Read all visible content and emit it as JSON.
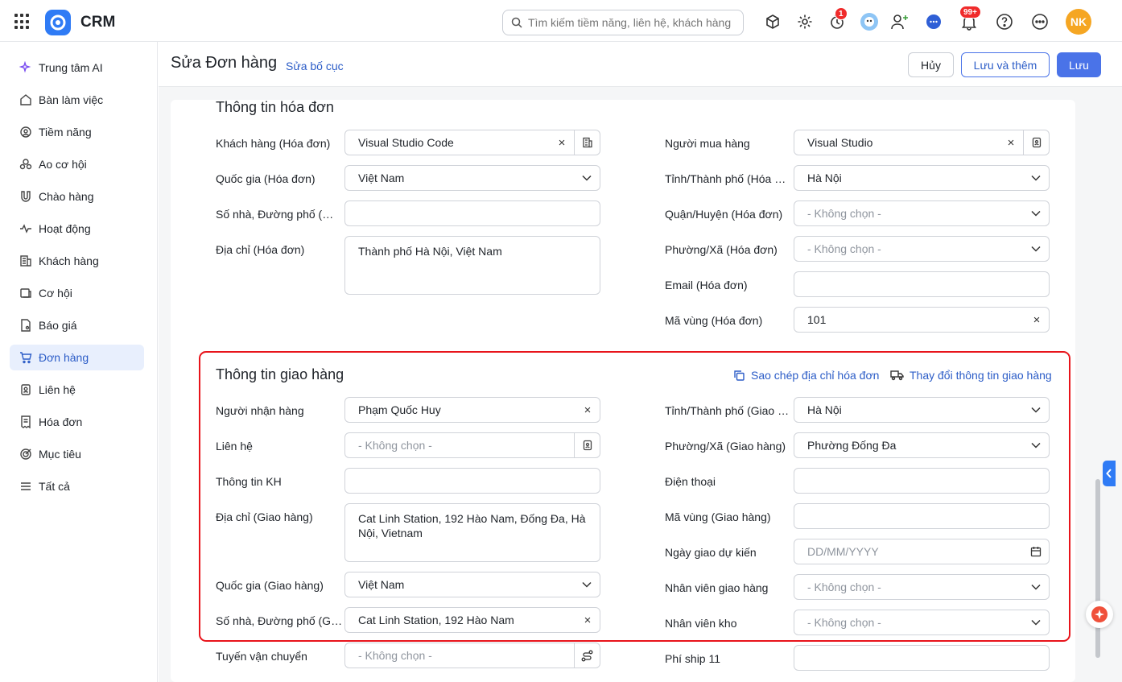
{
  "app": {
    "title": "CRM"
  },
  "search": {
    "placeholder": "Tìm kiếm tiềm năng, liên hệ, khách hàng"
  },
  "topbar": {
    "timer_badge": "1",
    "notif_badge": "99+",
    "avatar_initials": "NK"
  },
  "sidebar": {
    "items": [
      {
        "label": "Trung tâm AI",
        "icon": "sparkle-icon"
      },
      {
        "label": "Bàn làm việc",
        "icon": "home-icon"
      },
      {
        "label": "Tiềm năng",
        "icon": "target-user-icon"
      },
      {
        "label": "Ao cơ hội",
        "icon": "people-icon"
      },
      {
        "label": "Chào hàng",
        "icon": "magnet-icon"
      },
      {
        "label": "Hoạt động",
        "icon": "pulse-icon"
      },
      {
        "label": "Khách hàng",
        "icon": "building-icon"
      },
      {
        "label": "Cơ hội",
        "icon": "money-icon"
      },
      {
        "label": "Báo giá",
        "icon": "quote-doc-icon"
      },
      {
        "label": "Đơn hàng",
        "icon": "cart-icon",
        "active": true
      },
      {
        "label": "Liên hệ",
        "icon": "contact-icon"
      },
      {
        "label": "Hóa đơn",
        "icon": "invoice-icon"
      },
      {
        "label": "Mục tiêu",
        "icon": "goal-icon"
      },
      {
        "label": "Tất cả",
        "icon": "menu-icon"
      }
    ]
  },
  "page": {
    "title": "Sửa Đơn hàng",
    "edit_layout": "Sửa bố cục",
    "cancel": "Hủy",
    "save_add": "Lưu và thêm",
    "save": "Lưu"
  },
  "invoice": {
    "title": "Thông tin hóa đơn",
    "customer_label": "Khách hàng (Hóa đơn)",
    "customer_value": "Visual Studio Code",
    "country_label": "Quốc gia (Hóa đơn)",
    "country_value": "Việt Nam",
    "street_label": "Số nhà, Đường phố (Hóa đơn)",
    "street_value": "",
    "address_label": "Địa chỉ (Hóa đơn)",
    "address_value": "Thành phố Hà Nội, Việt Nam",
    "buyer_label": "Người mua hàng",
    "buyer_value": "Visual Studio",
    "province_label": "Tỉnh/Thành phố (Hóa đơn)",
    "province_value": "Hà Nội",
    "district_label": "Quận/Huyện (Hóa đơn)",
    "district_placeholder": "- Không chọn -",
    "ward_label": "Phường/Xã (Hóa đơn)",
    "ward_placeholder": "- Không chọn -",
    "email_label": "Email (Hóa đơn)",
    "email_value": "",
    "area_code_label": "Mã vùng (Hóa đơn)",
    "area_code_value": "101"
  },
  "shipping": {
    "title": "Thông tin giao hàng",
    "copy_action": "Sao chép địa chỉ hóa đơn",
    "change_action": "Thay đổi thông tin giao hàng",
    "recipient_label": "Người nhận hàng",
    "recipient_value": "Phạm Quốc Huy",
    "contact_label": "Liên hệ",
    "contact_placeholder": "- Không chọn -",
    "cust_info_label": "Thông tin KH",
    "cust_info_value": "",
    "address_label": "Địa chỉ (Giao hàng)",
    "address_value": "Cat Linh Station, 192 Hào Nam, Đống Đa, Hà Nội, Vietnam",
    "country_label": "Quốc gia (Giao hàng)",
    "country_value": "Việt Nam",
    "street_label": "Số nhà, Đường phố (Giao hàng)",
    "street_value": "Cat Linh Station, 192 Hào Nam",
    "province_label": "Tỉnh/Thành phố (Giao hàng)",
    "province_value": "Hà Nội",
    "ward_label": "Phường/Xã (Giao hàng)",
    "ward_value": "Phường Đống Đa",
    "phone_label": "Điện thoại",
    "phone_value": "",
    "area_code_label": "Mã vùng (Giao hàng)",
    "area_code_value": "",
    "expected_date_label": "Ngày giao dự kiến",
    "expected_date_placeholder": "DD/MM/YYYY",
    "shipper_label": "Nhân viên giao hàng",
    "shipper_placeholder": "- Không chọn -",
    "warehouse_label": "Nhân viên kho",
    "warehouse_placeholder": "- Không chọn -",
    "route_label": "Tuyến vận chuyển",
    "route_placeholder": "- Không chọn -",
    "ship_fee_label": "Phí ship 11",
    "ship_fee_value": ""
  },
  "colors": {
    "accent": "#4a73e8",
    "highlight": "#e8141b",
    "active_bg": "#e8effd"
  }
}
